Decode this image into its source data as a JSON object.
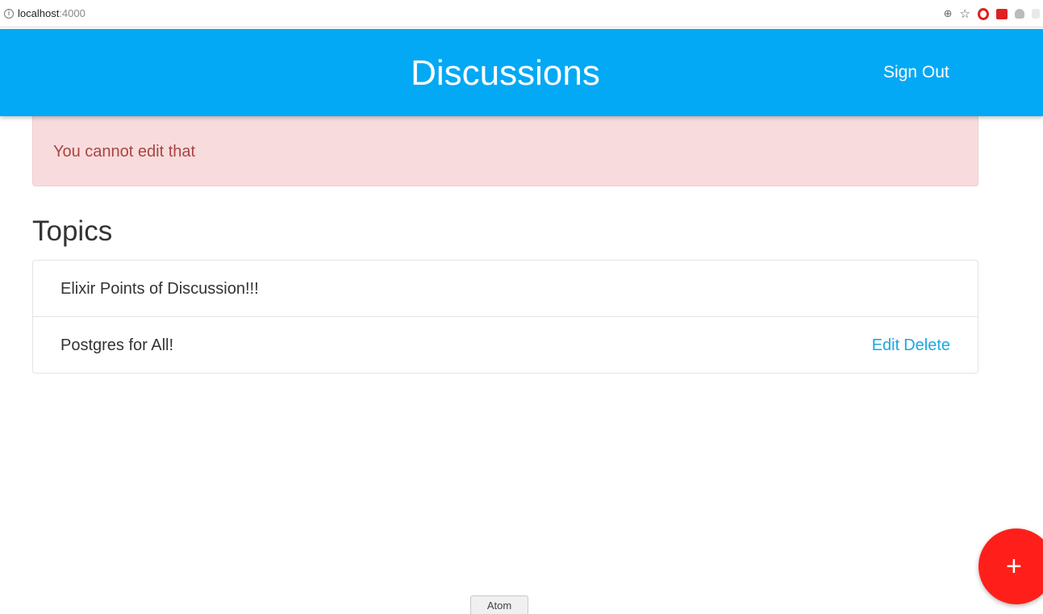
{
  "browser": {
    "url_host": "localhost",
    "url_port": ":4000",
    "icons": [
      "info-icon",
      "zoom-icon",
      "star-icon",
      "opera-icon",
      "extension-icon",
      "extension-icon",
      "extension-icon"
    ]
  },
  "navbar": {
    "brand": "Discussions",
    "signout_label": "Sign Out",
    "color": "#03a9f4"
  },
  "alert": {
    "message": "You cannot edit that",
    "background": "#f8dcdd",
    "text_color": "#a94442"
  },
  "main": {
    "heading": "Topics",
    "topics": [
      {
        "title": "Elixir Points of Discussion!!!"
      },
      {
        "title": "Postgres for All!",
        "edit_label": "Edit",
        "delete_label": "Delete"
      }
    ]
  },
  "fab": {
    "label": "+",
    "color": "#ff1f1a"
  },
  "taskbar_tooltip": "Atom"
}
